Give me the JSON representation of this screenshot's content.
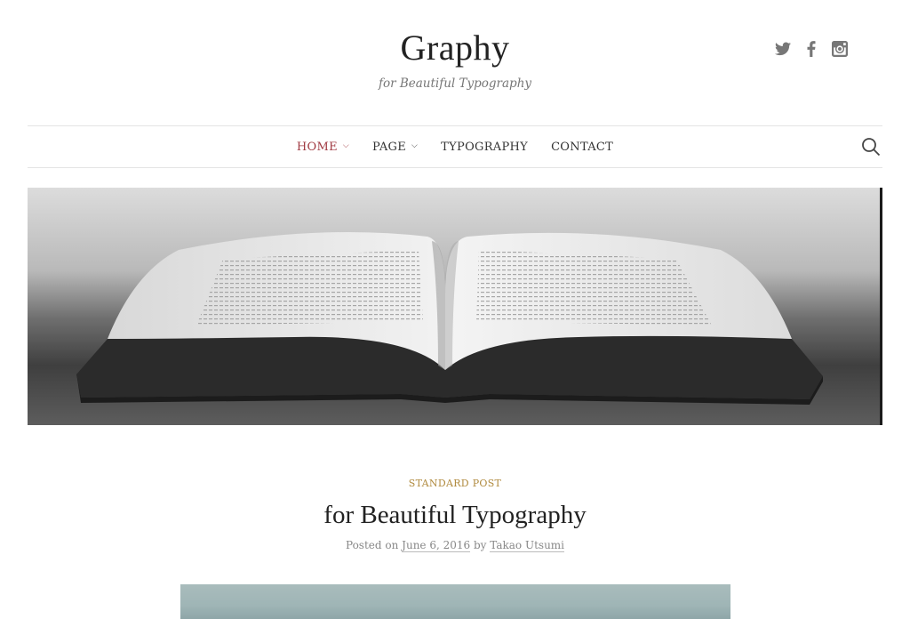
{
  "site": {
    "title": "Graphy",
    "tagline": "for Beautiful Typography"
  },
  "social": [
    {
      "icon": "twitter-icon"
    },
    {
      "icon": "facebook-icon"
    },
    {
      "icon": "instagram-icon"
    }
  ],
  "nav": {
    "items": [
      {
        "label": "HOME",
        "has_dropdown": true,
        "current": true
      },
      {
        "label": "PAGE",
        "has_dropdown": true,
        "current": false
      },
      {
        "label": "TYPOGRAPHY",
        "has_dropdown": false,
        "current": false
      },
      {
        "label": "CONTACT",
        "has_dropdown": false,
        "current": false
      }
    ],
    "search_icon": "search-icon"
  },
  "hero": {
    "image": "open-book-photo"
  },
  "post": {
    "category": "STANDARD POST",
    "title": "for Beautiful Typography",
    "meta_prefix": "Posted on",
    "date": "June 6, 2016",
    "by": "by",
    "author": "Takao Utsumi"
  },
  "colors": {
    "accent": "#a13b43",
    "category": "#b08a3e",
    "text": "#222222",
    "muted": "#888888"
  }
}
